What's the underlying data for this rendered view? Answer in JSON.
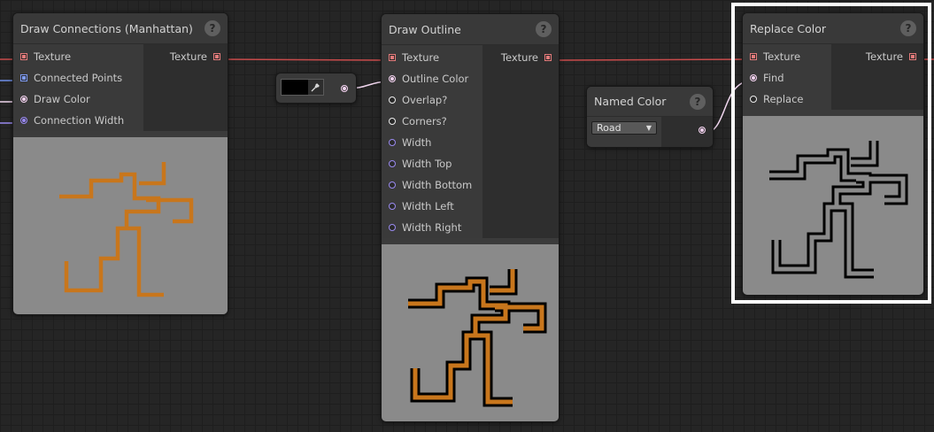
{
  "nodes": {
    "draw_connections": {
      "title": "Draw Connections (Manhattan)",
      "help": "?",
      "inputs": [
        "Texture",
        "Connected Points",
        "Draw Color",
        "Connection Width"
      ],
      "output": "Texture"
    },
    "draw_outline": {
      "title": "Draw Outline",
      "help": "?",
      "inputs": [
        "Texture",
        "Outline Color",
        "Overlap?",
        "Corners?",
        "Width",
        "Width Top",
        "Width Bottom",
        "Width Left",
        "Width Right"
      ],
      "output": "Texture"
    },
    "replace_color": {
      "title": "Replace Color",
      "help": "?",
      "inputs": [
        "Texture",
        "Find",
        "Replace"
      ],
      "output": "Texture"
    },
    "named_color": {
      "title": "Named Color",
      "help": "?",
      "selected_value": "Road"
    },
    "color_picker": {
      "color": "#000000",
      "picker_icon": "eyedropper-icon"
    }
  },
  "colors": {
    "texture_wire": "#c84b4b",
    "points_wire": "#6f8fe8",
    "color_wire": "#f0d6ee",
    "width_wire": "#9a8af0",
    "road_orange": "#c8761c",
    "outline_black": "#000000",
    "preview_bg": "#8a8a8a"
  }
}
